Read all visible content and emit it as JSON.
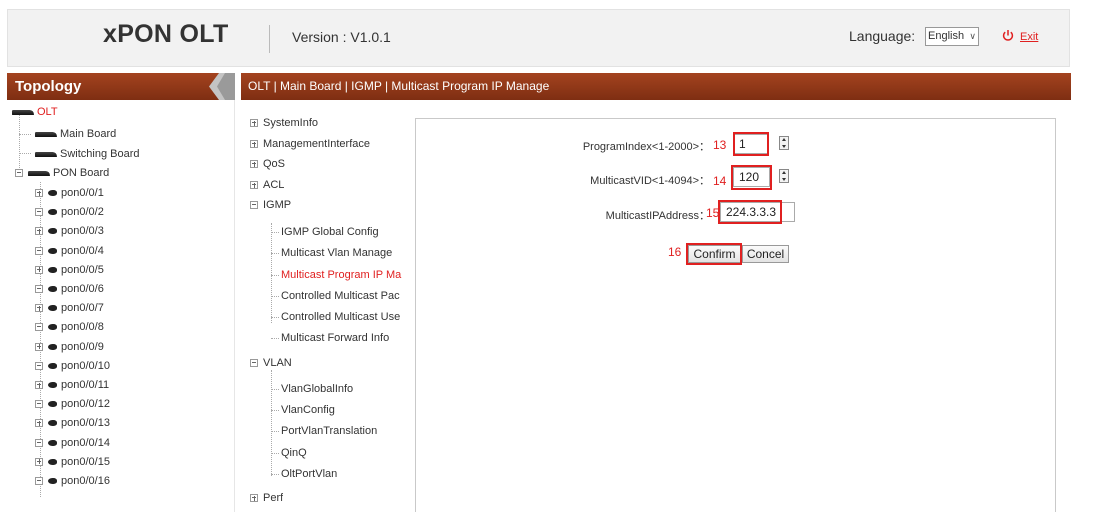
{
  "header": {
    "brand": "xPON OLT",
    "version": "Version : V1.0.1",
    "language_label": "Language:",
    "language_value": "English",
    "exit_label": "Exit",
    "exit_icon": "power-icon"
  },
  "topology": {
    "title": "Topology",
    "root": "OLT",
    "boards": [
      "Main Board",
      "Switching Board",
      "PON Board"
    ],
    "ports": [
      "pon0/0/1",
      "pon0/0/2",
      "pon0/0/3",
      "pon0/0/4",
      "pon0/0/5",
      "pon0/0/6",
      "pon0/0/7",
      "pon0/0/8",
      "pon0/0/9",
      "pon0/0/10",
      "pon0/0/11",
      "pon0/0/12",
      "pon0/0/13",
      "pon0/0/14",
      "pon0/0/15",
      "pon0/0/16"
    ]
  },
  "breadcrumb": "OLT | Main Board | IGMP | Multicast Program IP Manage",
  "menu": {
    "top_items": [
      "SystemInfo",
      "ManagementInterface",
      "QoS",
      "ACL",
      "IGMP"
    ],
    "igmp_items": [
      "IGMP Global Config",
      "Multicast Vlan Manage",
      "Multicast Program IP Ma",
      "Controlled Multicast Pac",
      "Controlled Multicast Use",
      "Multicast Forward Info"
    ],
    "vlan_label": "VLAN",
    "vlan_items": [
      "VlanGlobalInfo",
      "VlanConfig",
      "PortVlanTranslation",
      "QinQ",
      "OltPortVlan"
    ],
    "perf_label": "Perf"
  },
  "form": {
    "program_index_label": "ProgramIndex<1-2000>：",
    "program_index_step": "13",
    "program_index_value": "1",
    "vid_label": "MulticastVID<1-4094>：",
    "vid_step": "14",
    "vid_value": "120",
    "ip_label": "MulticastIPAddress：",
    "ip_step": "15",
    "ip_value": "224.3.3.3",
    "confirm_step": "16",
    "confirm_label": "Confirm",
    "cancel_label": "Concel"
  },
  "colors": {
    "bar": "#8e3716",
    "accent_red": "#e02020"
  }
}
